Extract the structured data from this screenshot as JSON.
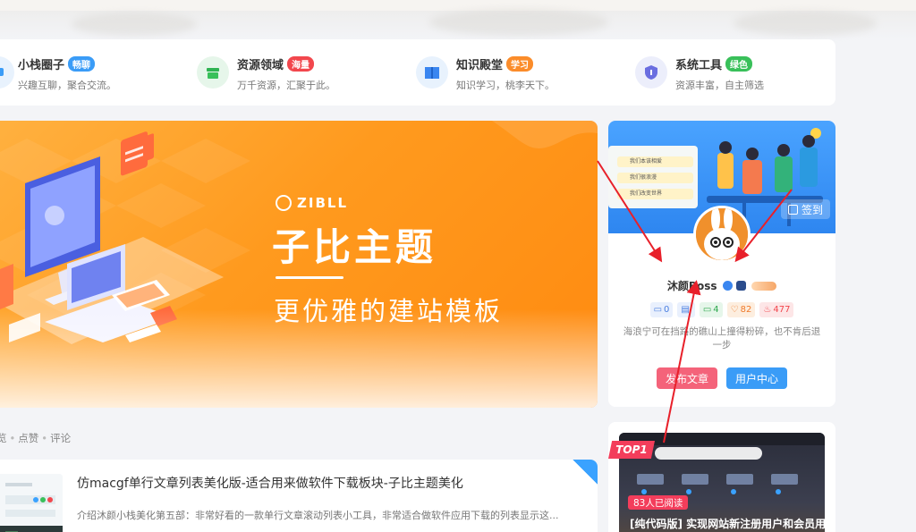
{
  "nav": {
    "items": [
      {
        "title": "小栈圈子",
        "badge": "畅聊",
        "badge_color": "#3a9cf7",
        "desc": "兴趣互聊，聚合交流。",
        "icon": "circle-chat-icon",
        "icon_bg": "#e8f2fd"
      },
      {
        "title": "资源领域",
        "badge": "海量",
        "badge_color": "#f2474d",
        "desc": "万千资源，汇聚于此。",
        "icon": "resource-box-icon",
        "icon_bg": "#e6f6ea"
      },
      {
        "title": "知识殿堂",
        "badge": "学习",
        "badge_color": "#fb8c2a",
        "desc": "知识学习，桃李天下。",
        "icon": "book-icon",
        "icon_bg": "#e8f2fd"
      },
      {
        "title": "系统工具",
        "badge": "绿色",
        "badge_color": "#39c05a",
        "desc": "资源丰富，自主筛选",
        "icon": "shield-icon",
        "icon_bg": "#eceefb"
      }
    ]
  },
  "banner": {
    "logo": "ZIBLL",
    "title": "子比主题",
    "subtitle": "更优雅的建站模板"
  },
  "user": {
    "cover_list": [
      "我们本该相爱",
      "我们很浪漫",
      "我们改变世界"
    ],
    "signin": "签到",
    "name": "沐颜Boss",
    "stats": [
      {
        "icon": "comment-icon",
        "value": "0",
        "color": "#4a7fe0",
        "bg": "#e9f0fd"
      },
      {
        "icon": "article-icon",
        "value": "",
        "color": "#4a7fe0",
        "bg": "#e9f0fd"
      },
      {
        "icon": "message-icon",
        "value": "4",
        "color": "#2fa84f",
        "bg": "#e6f6ea"
      },
      {
        "icon": "like-icon",
        "value": "82",
        "color": "#f07a2a",
        "bg": "#fdeedf"
      },
      {
        "icon": "fire-icon",
        "value": "477",
        "color": "#f2474d",
        "bg": "#fde6e7"
      }
    ],
    "motto": "海浪宁可在挡路的礁山上撞得粉碎，也不肯后退一步",
    "post_button": "发布文章",
    "center_button": "用户中心"
  },
  "list": {
    "tabs": [
      "览",
      "点赞",
      "评论"
    ]
  },
  "post": {
    "title": "仿macgf单行文章列表美化版-适合用来做软件下载板块-子比主题美化",
    "desc": "介绍沐颜小栈美化第五部：非常好看的一款单行文章滚动列表小工具，非常适合做软件应用下载的列表显示这..."
  },
  "hot": {
    "rank": "TOP1",
    "read_count": "83人已阅读",
    "title": "[纯代码版] 实现网站新注册用户和会员用"
  }
}
